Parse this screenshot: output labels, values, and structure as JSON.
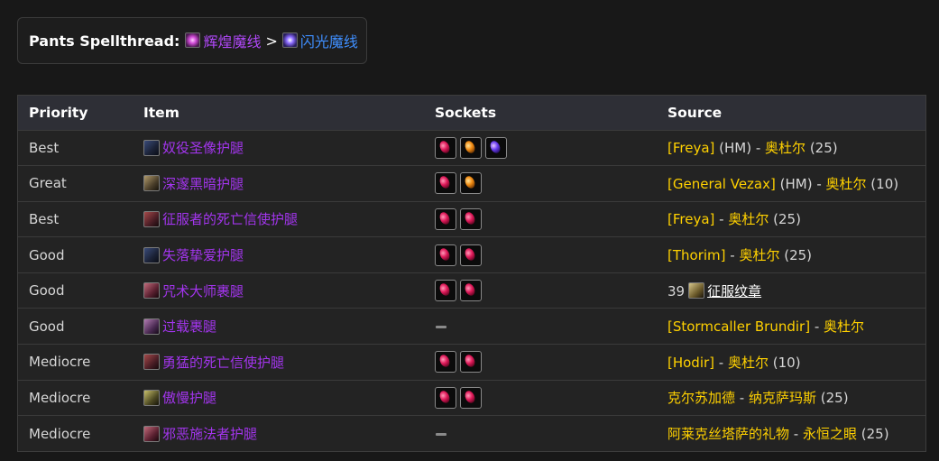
{
  "header": {
    "label": "Pants Spellthread:",
    "from": "辉煌魔线",
    "separator": ">",
    "to": "闪光魔线"
  },
  "columns": [
    "Priority",
    "Item",
    "Sockets",
    "Source"
  ],
  "rows": [
    {
      "priority": "Best",
      "item": "奴役圣像护腿",
      "sockets": [
        "red",
        "orange",
        "purple"
      ],
      "src_boss": "[Freya]",
      "src_mode": " (HM) - ",
      "src_zone": "奥杜尔",
      "src_size": " (25)"
    },
    {
      "priority": "Great",
      "item": "深邃黑暗护腿",
      "sockets": [
        "red",
        "orange"
      ],
      "src_boss": "[General Vezax]",
      "src_mode": " (HM) - ",
      "src_zone": "奥杜尔",
      "src_size": " (10)"
    },
    {
      "priority": "Best",
      "item": "征服者的死亡信使护腿",
      "sockets": [
        "red",
        "red"
      ],
      "src_boss": "[Freya]",
      "src_mode": " - ",
      "src_zone": "奥杜尔",
      "src_size": " (25)"
    },
    {
      "priority": "Good",
      "item": "失落挚爱护腿",
      "sockets": [
        "red",
        "red"
      ],
      "src_boss": "[Thorim]",
      "src_mode": " - ",
      "src_zone": "奥杜尔",
      "src_size": " (25)"
    },
    {
      "priority": "Good",
      "item": "咒术大师裹腿",
      "sockets": [
        "red",
        "red"
      ],
      "src_count": "39",
      "src_currency": "征服纹章"
    },
    {
      "priority": "Good",
      "item": "过载裹腿",
      "sockets": [],
      "src_boss": "[Stormcaller Brundir]",
      "src_mode": " - ",
      "src_zone": "奥杜尔",
      "src_size": ""
    },
    {
      "priority": "Mediocre",
      "item": "勇猛的死亡信使护腿",
      "sockets": [
        "red",
        "red"
      ],
      "src_boss": "[Hodir]",
      "src_mode": " - ",
      "src_zone": "奥杜尔",
      "src_size": " (10)"
    },
    {
      "priority": "Mediocre",
      "item": "傲慢护腿",
      "sockets": [
        "red",
        "red"
      ],
      "src_boss": "克尔苏加德",
      "src_mode": " - ",
      "src_zone": "纳克萨玛斯",
      "src_size": " (25)"
    },
    {
      "priority": "Mediocre",
      "item": "邪恶施法者护腿",
      "sockets": [],
      "src_boss": "阿莱克丝塔萨的礼物",
      "src_mode": " - ",
      "src_zone": "永恒之眼",
      "src_size": " (25)"
    }
  ]
}
